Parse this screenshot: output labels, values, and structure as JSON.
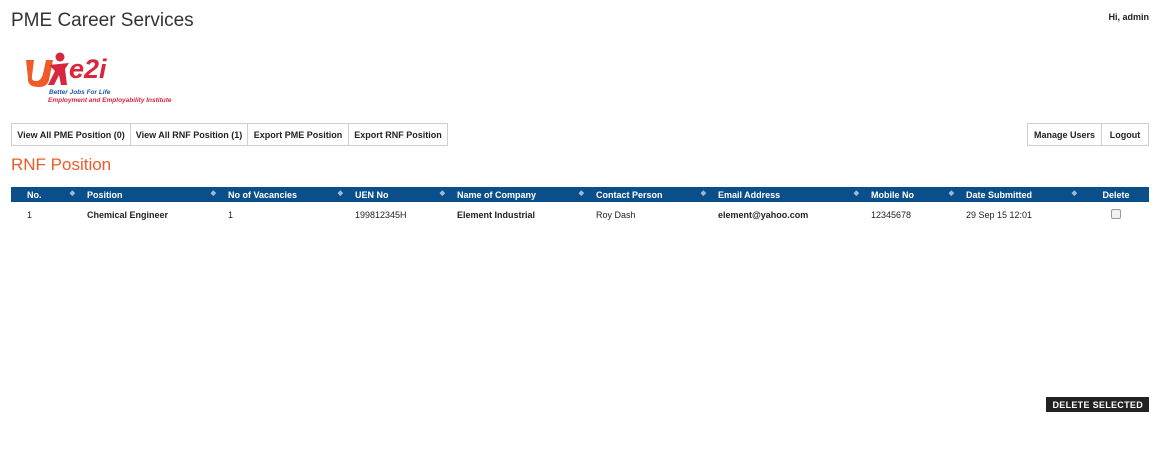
{
  "header": {
    "app_title": "PME Career Services",
    "greeting": "Hi, admin"
  },
  "logo": {
    "brand": "e2i",
    "tagline1": "Better Jobs For Life",
    "tagline2": "Employment and Employability Institute",
    "colors": {
      "orange": "#f05a28",
      "red": "#d7263d",
      "blue": "#1f5aa8"
    }
  },
  "toolbar": {
    "view_pme_label": "View All PME Position (0)",
    "view_rnf_label": "View All RNF Position (1)",
    "export_pme_label": "Export PME Position",
    "export_rnf_label": "Export RNF Position",
    "manage_users_label": "Manage Users",
    "logout_label": "Logout"
  },
  "page": {
    "heading": "RNF Position"
  },
  "table": {
    "columns": [
      "No.",
      "Position",
      "No of Vacancies",
      "UEN No",
      "Name of Company",
      "Contact Person",
      "Email Address",
      "Mobile No",
      "Date Submitted",
      "Delete"
    ],
    "rows": [
      [
        "1",
        "Chemical Engineer",
        "1",
        "199812345H",
        "Element Industrial",
        "Roy Dash",
        "element@yahoo.com",
        "12345678",
        "29 Sep 15 12:01",
        ""
      ]
    ]
  },
  "actions": {
    "delete_selected_label": "DELETE SELECTED"
  },
  "colors": {
    "header_bg": "#0a4f8a",
    "accent": "#f05a28"
  }
}
